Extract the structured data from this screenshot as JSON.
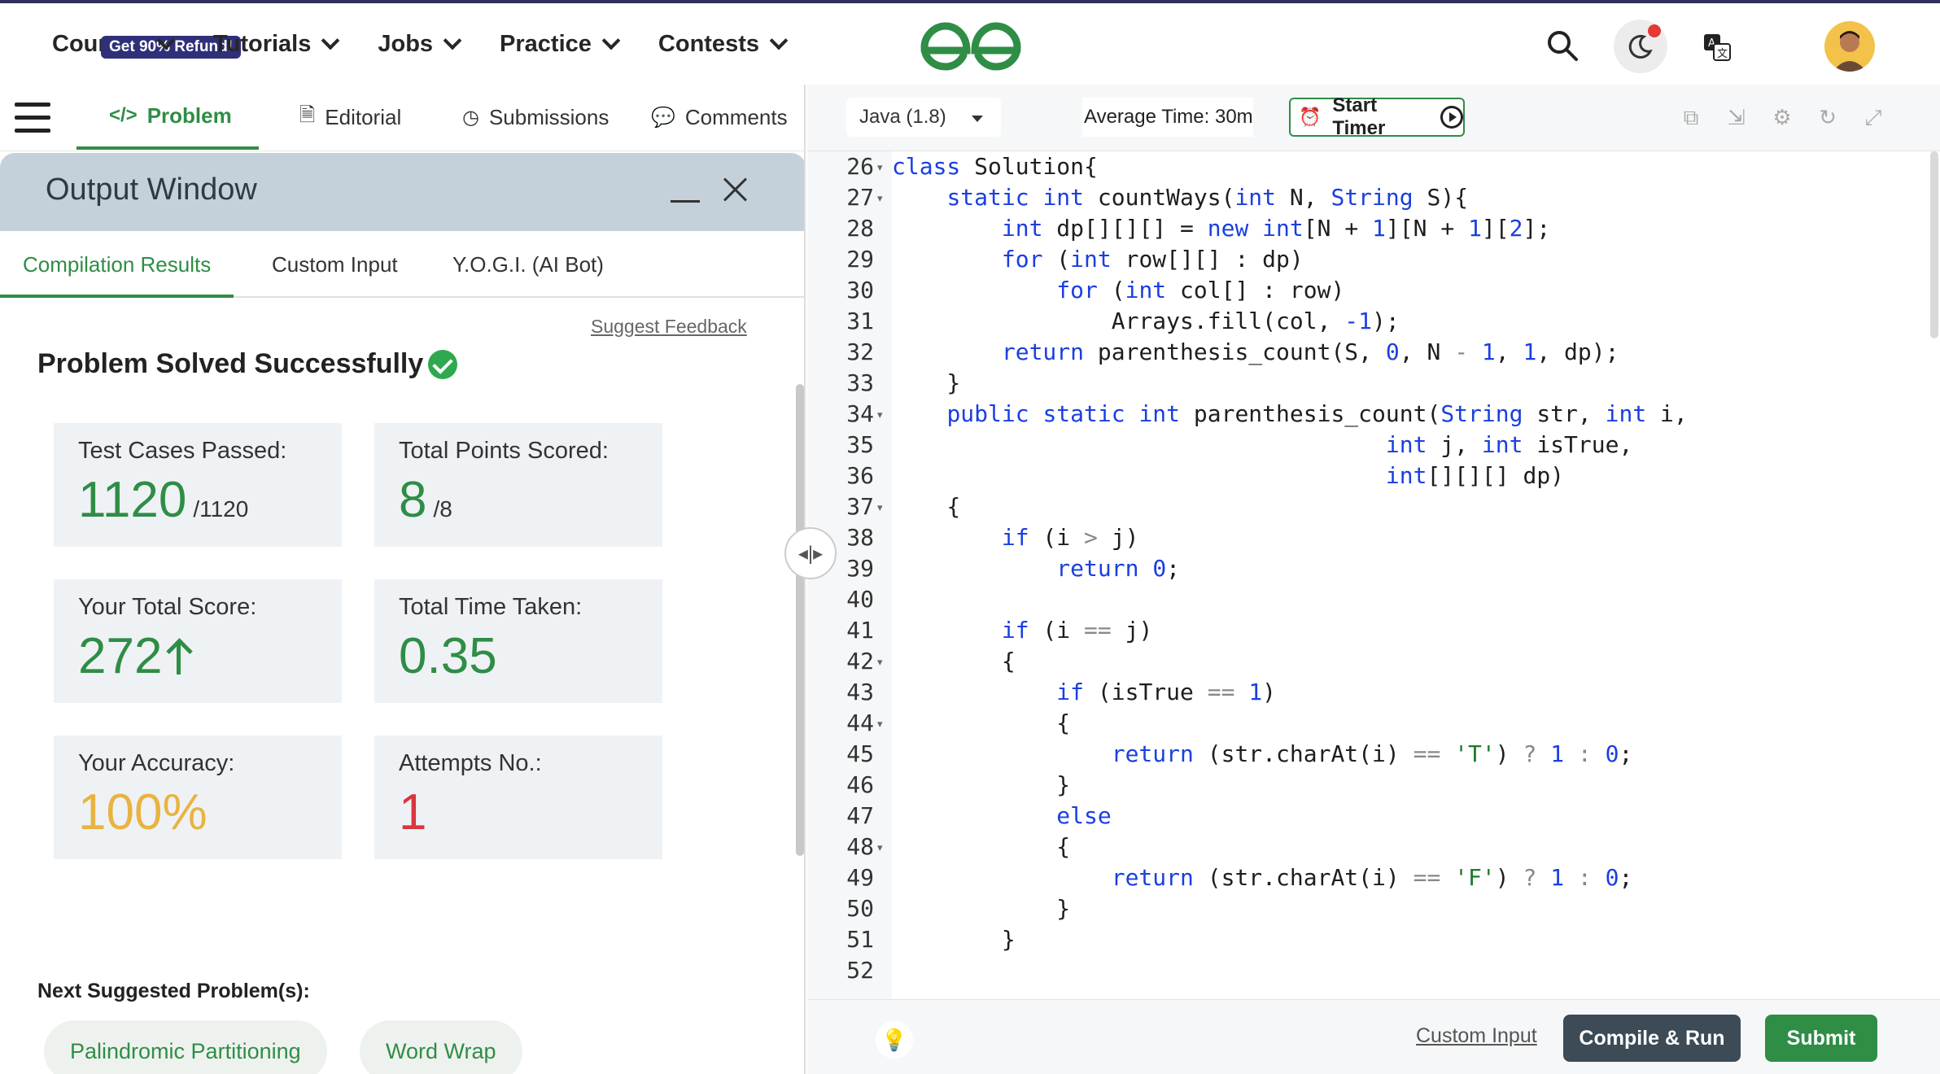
{
  "topnav": {
    "refund_badge": "Get 90% Refund!",
    "items": [
      "Courses",
      "Tutorials",
      "Jobs",
      "Practice",
      "Contests"
    ],
    "brand_color": "#2f8d46"
  },
  "left_tabs": {
    "problem": "Problem",
    "editorial": "Editorial",
    "submissions": "Submissions",
    "comments": "Comments"
  },
  "output_window": {
    "title": "Output Window",
    "subtabs": [
      "Compilation Results",
      "Custom Input",
      "Y.O.G.I. (AI Bot)"
    ],
    "suggest_feedback": "Suggest Feedback",
    "solved_text": "Problem Solved Successfully",
    "cards": {
      "test_cases": {
        "label": "Test Cases Passed:",
        "value": "1120",
        "sub": "/1120"
      },
      "points": {
        "label": "Total Points Scored:",
        "value": "8",
        "sub": "/8"
      },
      "total_score": {
        "label": "Your Total Score:",
        "value": "272"
      },
      "time_taken": {
        "label": "Total Time Taken:",
        "value": "0.35"
      },
      "accuracy": {
        "label": "Your Accuracy:",
        "value": "100%"
      },
      "attempts": {
        "label": "Attempts No.:",
        "value": "1"
      }
    },
    "next_label": "Next Suggested Problem(s):",
    "suggestions": [
      "Palindromic Partitioning",
      "Word Wrap"
    ]
  },
  "editor": {
    "language": "Java (1.8)",
    "average_time": "Average Time: 30m",
    "start_timer": "Start Timer",
    "lines": [
      {
        "n": "26",
        "fold": true
      },
      {
        "n": "27",
        "fold": true
      },
      {
        "n": "28",
        "fold": false
      },
      {
        "n": "29",
        "fold": false
      },
      {
        "n": "30",
        "fold": false
      },
      {
        "n": "31",
        "fold": false
      },
      {
        "n": "32",
        "fold": false
      },
      {
        "n": "33",
        "fold": false
      },
      {
        "n": "34",
        "fold": true
      },
      {
        "n": "35",
        "fold": false
      },
      {
        "n": "36",
        "fold": false
      },
      {
        "n": "37",
        "fold": true
      },
      {
        "n": "38",
        "fold": false
      },
      {
        "n": "39",
        "fold": false
      },
      {
        "n": "40",
        "fold": false
      },
      {
        "n": "41",
        "fold": false
      },
      {
        "n": "42",
        "fold": true
      },
      {
        "n": "43",
        "fold": false
      },
      {
        "n": "44",
        "fold": true
      },
      {
        "n": "45",
        "fold": false
      },
      {
        "n": "46",
        "fold": false
      },
      {
        "n": "47",
        "fold": false
      },
      {
        "n": "48",
        "fold": true
      },
      {
        "n": "49",
        "fold": false
      },
      {
        "n": "50",
        "fold": false
      },
      {
        "n": "51",
        "fold": false
      },
      {
        "n": "52",
        "fold": false
      }
    ],
    "custom_input_link": "Custom Input",
    "compile_run": "Compile & Run",
    "submit": "Submit"
  }
}
